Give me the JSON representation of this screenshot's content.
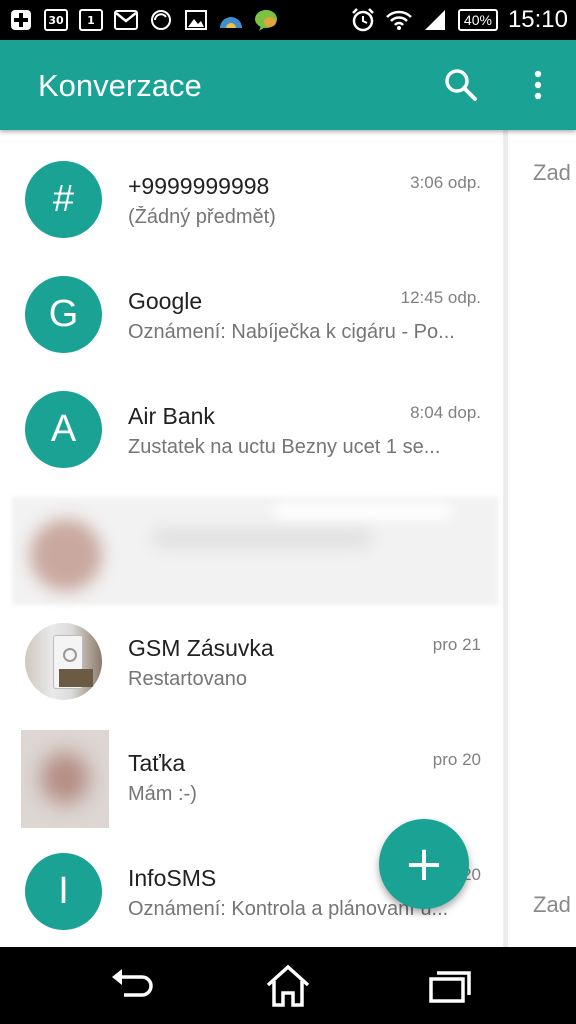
{
  "status_bar": {
    "calendar_day": "30",
    "date_badge": "1",
    "battery": "40%",
    "time": "15:10",
    "icons": [
      "add-icon",
      "calendar-icon",
      "date-icon",
      "gmail-icon",
      "sync-icon",
      "image-icon",
      "weather-icon",
      "go-sms-icon",
      "alarm-icon",
      "wifi-icon",
      "signal-icon",
      "battery-icon"
    ]
  },
  "app_bar": {
    "title": "Konverzace",
    "actions": [
      "search-icon",
      "more-vert-icon"
    ]
  },
  "accent_color": "#1aa295",
  "conversations": [
    {
      "avatar_letter": "#",
      "name": "+9999999998",
      "preview": "(Žádný předmět)",
      "time": "3:06 odp."
    },
    {
      "avatar_letter": "G",
      "name": "Google",
      "preview": "Oznámení: Nabíječka k cigáru - Po...",
      "time": "12:45 odp."
    },
    {
      "avatar_letter": "A",
      "name": "Air Bank",
      "preview": "Zustatek na uctu Bezny ucet 1 se...",
      "time": "8:04 dop."
    },
    {
      "name": "GSM Zásuvka",
      "preview": "Restartovano",
      "time": "pro 21"
    },
    {
      "name": "Taťka",
      "preview": "Mám :-)",
      "time": "pro 20"
    },
    {
      "avatar_letter": "I",
      "name": "InfoSMS",
      "preview": "Oznámení: Kontrola a plánovaní ú...",
      "time": "pro 20"
    }
  ],
  "side_panel": {
    "top_text": "Zad",
    "bottom_text": "Zad"
  },
  "fab": {
    "label": "+"
  }
}
